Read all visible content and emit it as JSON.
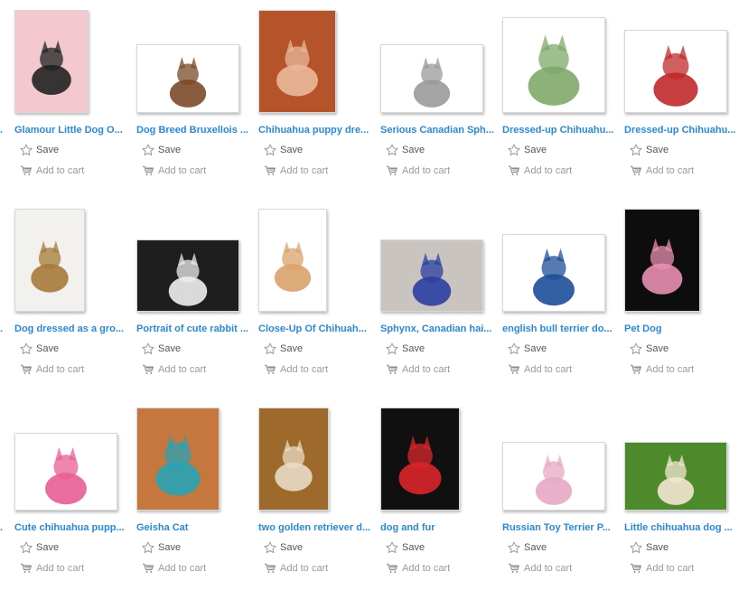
{
  "actions": {
    "save_label": "Save",
    "cart_label": "Add to cart"
  },
  "colors": {
    "link": "#2a88d5",
    "action_text": "#555555",
    "cart_text": "#9a9a9a",
    "star_outline": "#9a9a9a"
  },
  "results": [
    {
      "title": "Glamour Little Dog O...",
      "image": "chihuahua-pink-sofa",
      "bg": "#f3c9cf",
      "fg": "#222222"
    },
    {
      "title": "Dog Breed Bruxellois ...",
      "image": "brussels-griffon-sweater",
      "bg": "#ffffff",
      "fg": "#7a4a2a"
    },
    {
      "title": "Chihuahua puppy dre...",
      "image": "chihuahua-fur-hood",
      "bg": "#b5542a",
      "fg": "#e9b89a"
    },
    {
      "title": "Serious Canadian Sph...",
      "image": "sphynx-gray-scarf",
      "bg": "#ffffff",
      "fg": "#9a9a9a"
    },
    {
      "title": "Dressed-up Chihuahu...",
      "image": "chihuahua-green-outfit",
      "bg": "#ffffff",
      "fg": "#7faa6a"
    },
    {
      "title": "Dressed-up Chihuahu...",
      "image": "puppy-red-vest",
      "bg": "#ffffff",
      "fg": "#c0292b"
    },
    {
      "title": "Dog dressed as a gro...",
      "image": "dog-wicker-chair",
      "bg": "#f3f1ed",
      "fg": "#a67a3a"
    },
    {
      "title": "Portrait of cute rabbit ...",
      "image": "rabbit-black-hat",
      "bg": "#1e1e1e",
      "fg": "#eeeeee"
    },
    {
      "title": "Close-Up Of Chihuah...",
      "image": "chihuahua-blue-sweater",
      "bg": "#ffffff",
      "fg": "#d9a26a"
    },
    {
      "title": "Sphynx, Canadian hai...",
      "image": "sphynx-blue-scarf",
      "bg": "#c9c4c0",
      "fg": "#2a3fa0"
    },
    {
      "title": "english bull terrier do...",
      "image": "bull-terrier-sweater",
      "bg": "#ffffff",
      "fg": "#1d4f9a"
    },
    {
      "title": "Pet Dog",
      "image": "dog-pink-coat-black",
      "bg": "#0d0d0d",
      "fg": "#e88fb0"
    },
    {
      "title": "Cute chihuahua pupp...",
      "image": "chihuahua-pink-hat",
      "bg": "#ffffff",
      "fg": "#e85d93"
    },
    {
      "title": "Geisha Cat",
      "image": "cat-kimono",
      "bg": "#c5773e",
      "fg": "#27a3b5"
    },
    {
      "title": "two golden retriever d...",
      "image": "retrievers-suits",
      "bg": "#9e6a2b",
      "fg": "#e8dcc6"
    },
    {
      "title": "dog and fur",
      "image": "dog-red-hoodie",
      "bg": "#101010",
      "fg": "#d9262a"
    },
    {
      "title": "Russian Toy Terrier P...",
      "image": "toy-terrier-pink",
      "bg": "#ffffff",
      "fg": "#e7a8c3"
    },
    {
      "title": "Little chihuahua dog ...",
      "image": "chihuahua-picnic-grass",
      "bg": "#4c8a2c",
      "fg": "#f3e6d2"
    }
  ]
}
